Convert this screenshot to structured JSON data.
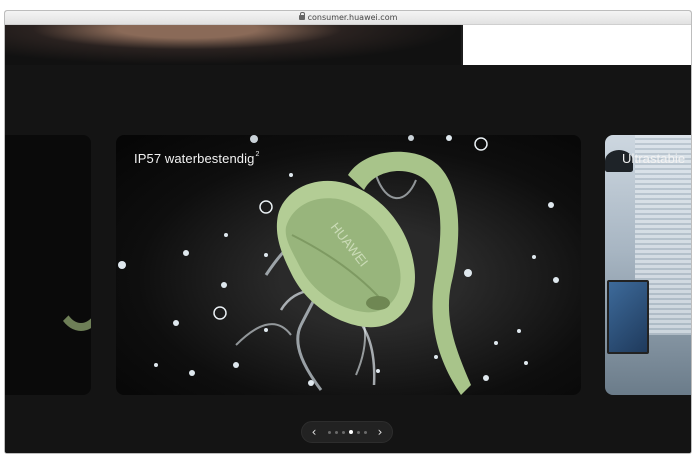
{
  "browser": {
    "url": "consumer.huawei.com"
  },
  "carousel": {
    "cards": [
      {
        "title": "",
        "position": "previous"
      },
      {
        "title": "IP57 waterbestendig",
        "footnote": "2",
        "position": "current"
      },
      {
        "title": "Ultrastabie",
        "position": "next"
      }
    ],
    "pager": {
      "prev_icon": "chevron-left-icon",
      "next_icon": "chevron-right-icon",
      "prev_glyph": "‹",
      "next_glyph": "›",
      "dot_count": 6,
      "active_dot": 3
    }
  },
  "colors": {
    "background": "#141414",
    "earbud_green": "#a8c48a",
    "accent_white": "#ffffff"
  }
}
